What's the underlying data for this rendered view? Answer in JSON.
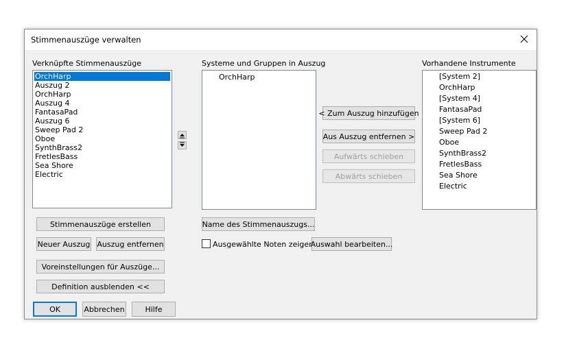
{
  "window": {
    "title": "Stimmenauszüge verwalten"
  },
  "linked": {
    "label": "Verknüpfte Stimmenauszüge",
    "items": [
      "OrchHarp",
      "Auszug 2",
      "OrchHarp",
      "Auszug 4",
      "FantasaPad",
      "Auszug 6",
      "Sweep Pad 2",
      "Oboe",
      "SynthBrass2",
      "FretlesBass",
      "Sea Shore",
      "Electric"
    ],
    "selected": 0
  },
  "systems": {
    "label": "Systeme und Gruppen in Auszug",
    "items": [
      "OrchHarp"
    ]
  },
  "available": {
    "label": "Vorhandene Instrumente",
    "items": [
      "[System 2]",
      "OrchHarp",
      "[System 4]",
      "FantasaPad",
      "[System 6]",
      "Sweep Pad 2",
      "Oboe",
      "SynthBrass2",
      "FretlesBass",
      "Sea Shore",
      "Electric"
    ]
  },
  "buttons": {
    "add": "< Zum Auszug hinzufügen",
    "remove": "Aus Auszug entfernen >",
    "move_up": "Aufwärts schieben",
    "move_down": "Abwärts schieben",
    "create_parts": "Stimmenauszüge erstellen",
    "new_part": "Neuer Auszug",
    "delete_part": "Auszug entfernen",
    "part_defaults": "Voreinstellungen für Auszüge...",
    "hide_definition": "Definition ausblenden <<",
    "part_name": "Name des Stimmenauszugs...",
    "edit_selection": "Auswahl bearbeiten...",
    "ok": "OK",
    "cancel": "Abbrechen",
    "help": "Hilfe"
  },
  "show_selected": {
    "label": "Ausgewählte Noten zeigen",
    "checked": false
  }
}
